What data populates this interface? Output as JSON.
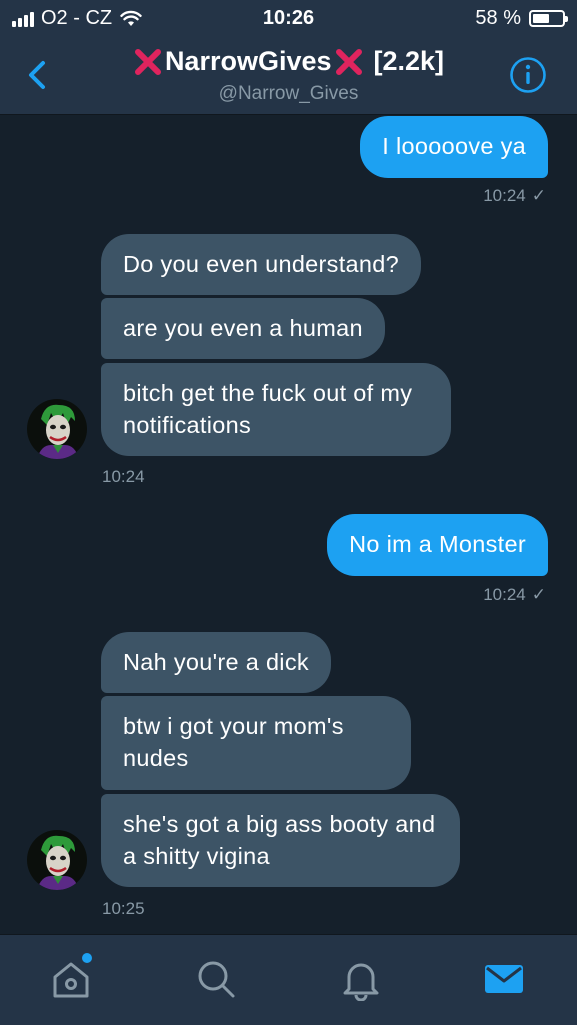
{
  "status_bar": {
    "carrier": "O2 - CZ",
    "time": "10:26",
    "battery_percent": "58 %",
    "battery_level": 0.58
  },
  "header": {
    "title": "NarrowGives",
    "title_suffix": "[2.2k]",
    "handle": "@Narrow_Gives"
  },
  "messages": [
    {
      "direction": "out",
      "text": "I looooove ya"
    },
    {
      "direction": "in",
      "text": "Do you even understand?"
    },
    {
      "direction": "in",
      "text": "are you even a human"
    },
    {
      "direction": "in",
      "text": "bitch get the fuck out of my notifications"
    },
    {
      "direction": "out",
      "text": "No im a Monster"
    },
    {
      "direction": "in",
      "text": "Nah you're a dick"
    },
    {
      "direction": "in",
      "text": "btw i got your mom's nudes"
    },
    {
      "direction": "in",
      "text": "she's got a big ass booty and a shitty vigina"
    }
  ],
  "timestamps": [
    "10:24",
    "10:24",
    "10:24",
    "10:25"
  ],
  "icons": {
    "back": "chevron-left-icon",
    "info": "info-icon",
    "title_decoration": "red-x-icon",
    "tabs": [
      "home-icon",
      "search-icon",
      "notifications-icon",
      "messages-icon"
    ]
  },
  "colors": {
    "background": "#15202b",
    "bar": "#243447",
    "accent": "#1da1f2",
    "incoming_bubble": "#3d5466",
    "muted_text": "#8899a6",
    "x_mark": "#e0245e"
  }
}
